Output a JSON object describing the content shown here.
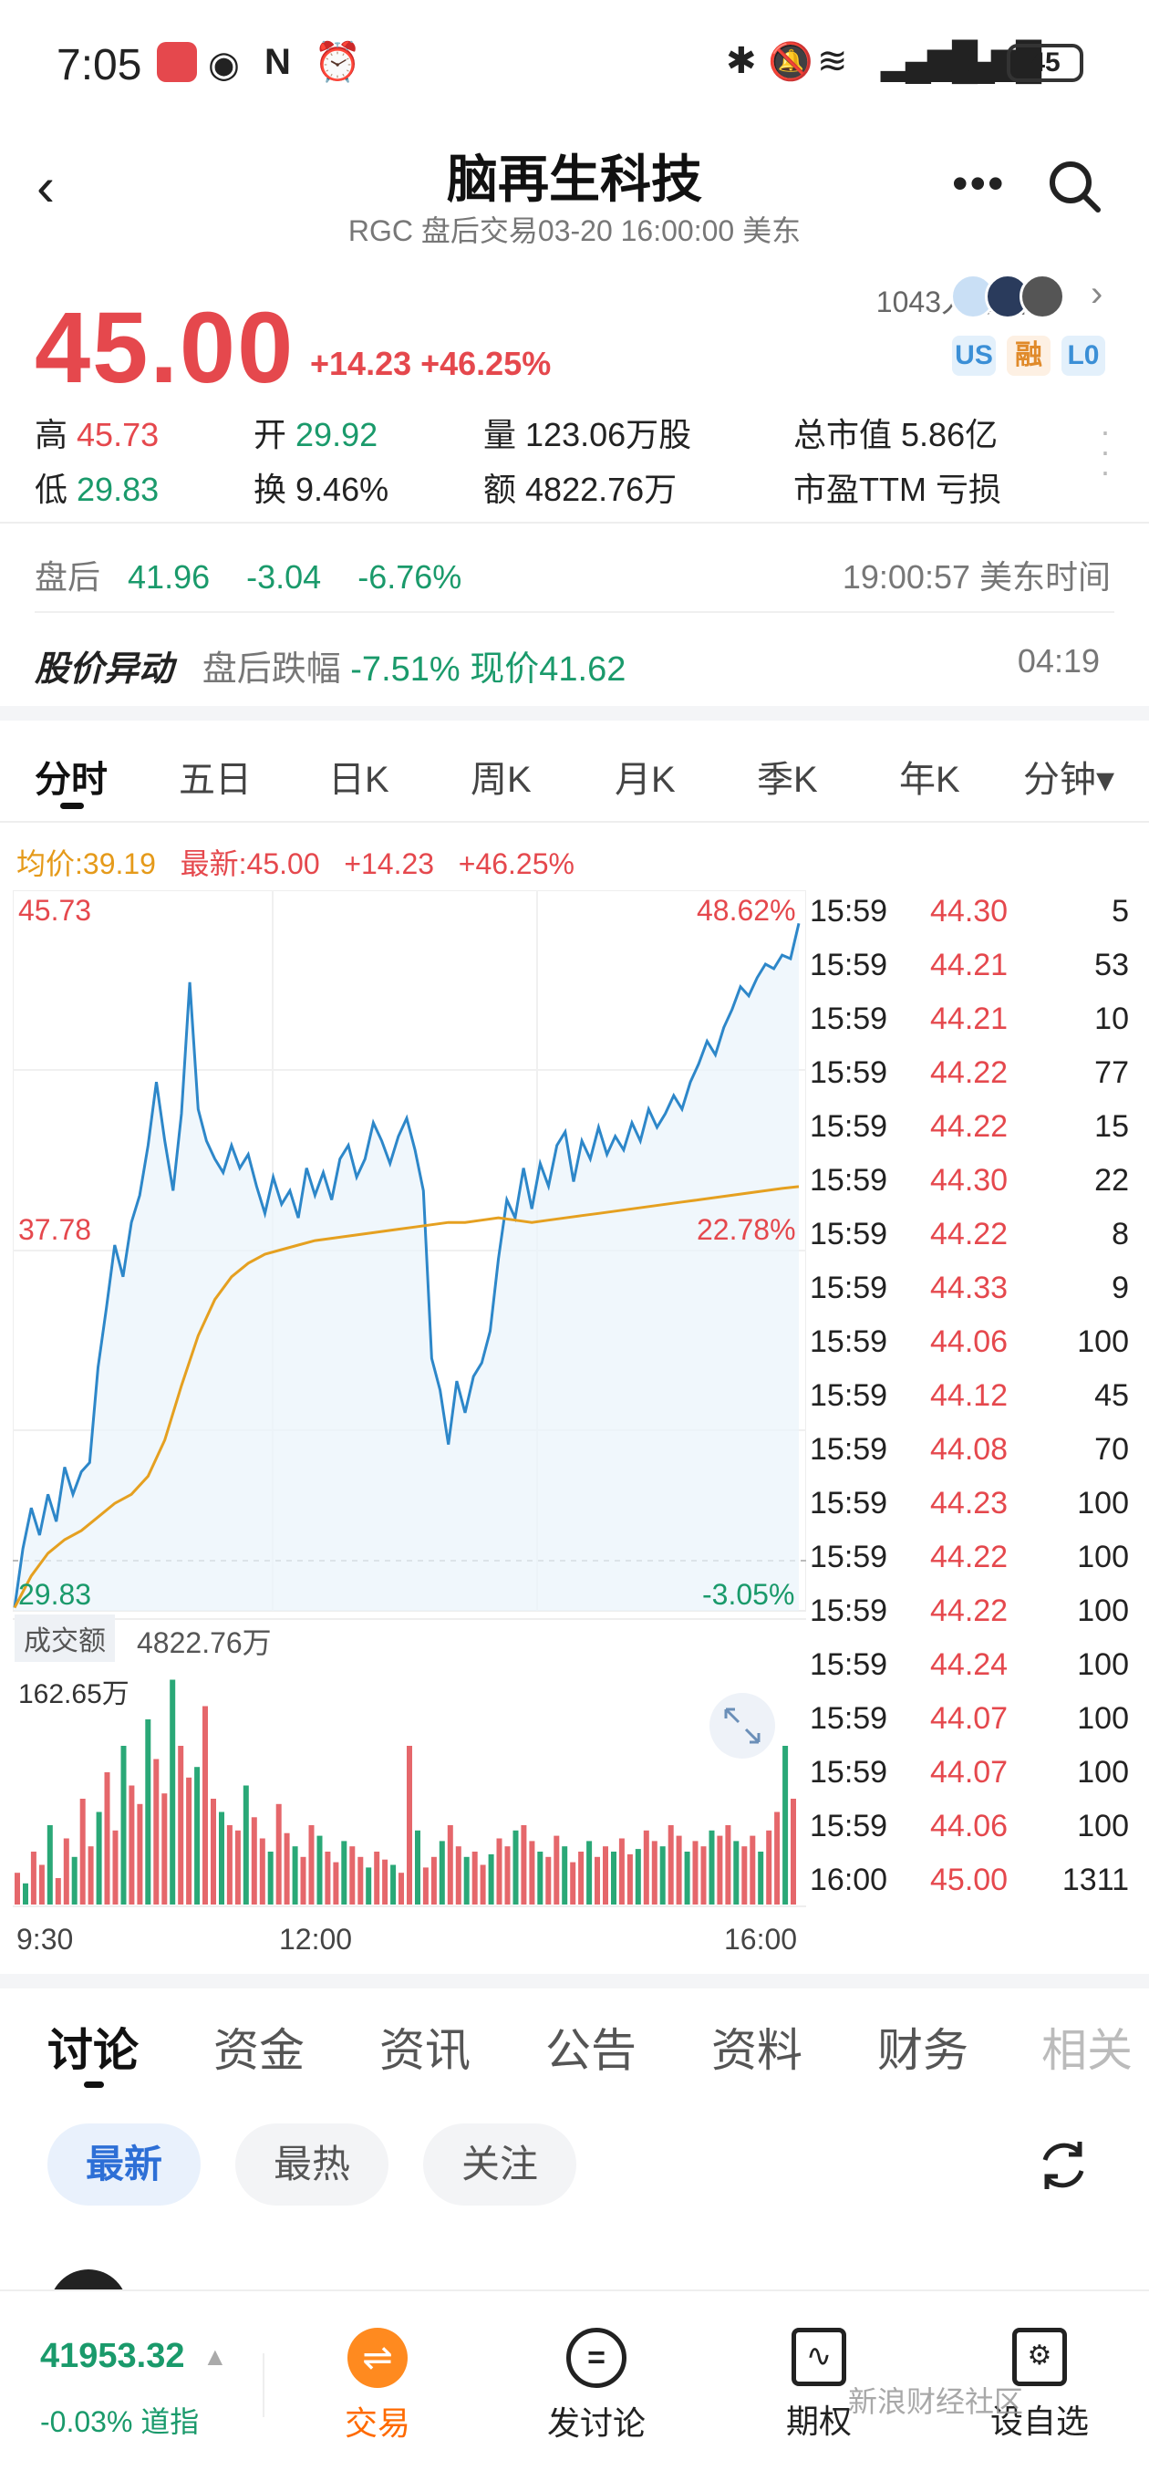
{
  "status_bar": {
    "time": "7:05",
    "battery": "45"
  },
  "header": {
    "back_icon": "chevron-left-icon",
    "title": "脑再生科技",
    "subtitle": "RGC 盘后交易03-20 16:00:00 美东",
    "more_icon": "more-icon",
    "search_icon": "search-icon"
  },
  "quote": {
    "price": "45.00",
    "change": "+14.23 +46.25%",
    "followers": "1043人加自选",
    "badges": [
      "US",
      "融",
      "L0"
    ],
    "high_label": "高",
    "high": "45.73",
    "open_label": "开",
    "open": "29.92",
    "volume_label": "量",
    "volume": "123.06万股",
    "mktcap_label": "总市值",
    "mktcap": "5.86亿",
    "low_label": "低",
    "low": "29.83",
    "turnover_label": "换",
    "turnover": "9.46%",
    "amount_label": "额",
    "amount": "4822.76万",
    "pe_label": "市盈TTM",
    "pe": "亏损"
  },
  "afterhours": {
    "label": "盘后",
    "price": "41.96",
    "change": "-3.04",
    "pct": "-6.76%",
    "time": "19:00:57 美东时间"
  },
  "alert": {
    "title": "股价异动",
    "text": "盘后跌幅",
    "pct": "-7.51%",
    "now": "现价41.62",
    "time": "04:19"
  },
  "chart_tabs": [
    "分时",
    "五日",
    "日K",
    "周K",
    "月K",
    "季K",
    "年K",
    "分钟▾"
  ],
  "chart_info": {
    "avg": "均价:39.19",
    "latest": "最新:45.00",
    "chg": "+14.23",
    "pct": "+46.25%"
  },
  "chart_data": {
    "type": "line",
    "y_left": {
      "top": "45.73",
      "mid": "37.78",
      "bottom": "29.83"
    },
    "y_right": {
      "top": "48.62%",
      "mid": "22.78%",
      "bottom": "-3.05%"
    },
    "ylim": [
      29.83,
      45.73
    ],
    "x_labels": [
      "9:30",
      "12:00",
      "16:00"
    ],
    "series": [
      {
        "values": [
          29.9,
          31.2,
          32.1,
          31.5,
          32.4,
          31.8,
          33.0,
          32.4,
          32.9,
          33.1,
          35.2,
          36.5,
          37.9,
          37.2,
          38.4,
          39.0,
          40.1,
          41.5,
          40.2,
          39.1,
          40.8,
          43.7,
          40.9,
          40.2,
          39.8,
          39.5,
          40.1,
          39.6,
          39.9,
          39.2,
          38.6,
          39.4,
          38.8,
          39.1,
          38.5,
          39.6,
          39.0,
          39.5,
          38.9,
          39.8,
          40.1,
          39.4,
          39.8,
          40.6,
          40.2,
          39.7,
          40.3,
          40.7,
          40.0,
          39.1,
          35.4,
          34.7,
          33.5,
          34.9,
          34.2,
          35.0,
          35.3,
          36.0,
          37.6,
          38.9,
          38.5,
          39.6,
          38.7,
          39.7,
          39.2,
          40.1,
          40.4,
          39.3,
          40.2,
          39.8,
          40.5,
          39.9,
          40.3,
          40.0,
          40.6,
          40.2,
          40.9,
          40.5,
          40.8,
          41.2,
          40.9,
          41.5,
          41.9,
          42.4,
          42.1,
          42.7,
          43.1,
          43.6,
          43.4,
          43.8,
          44.1,
          44.0,
          44.3,
          44.22,
          45.0
        ]
      },
      {
        "values": [
          29.9,
          30.6,
          31.1,
          31.4,
          31.6,
          31.9,
          32.2,
          32.4,
          32.8,
          33.6,
          34.8,
          35.9,
          36.7,
          37.2,
          37.5,
          37.7,
          37.8,
          37.9,
          38.0,
          38.05,
          38.1,
          38.15,
          38.2,
          38.25,
          38.3,
          38.35,
          38.4,
          38.4,
          38.45,
          38.5,
          38.45,
          38.4,
          38.45,
          38.5,
          38.55,
          38.6,
          38.65,
          38.7,
          38.75,
          38.8,
          38.85,
          38.9,
          38.95,
          39.0,
          39.05,
          39.1,
          39.15,
          39.19
        ]
      }
    ]
  },
  "volume": {
    "label": "成交额",
    "total": "4822.76万",
    "max": "162.65万",
    "bars": [
      12,
      8,
      20,
      15,
      30,
      10,
      25,
      18,
      40,
      22,
      35,
      50,
      28,
      60,
      45,
      38,
      70,
      55,
      42,
      85,
      60,
      48,
      52,
      75,
      40,
      35,
      30,
      28,
      45,
      33,
      25,
      20,
      38,
      27,
      22,
      18,
      30,
      26,
      20,
      16,
      24,
      22,
      18,
      14,
      20,
      17,
      15,
      12,
      60,
      28,
      14,
      18,
      24,
      30,
      22,
      18,
      20,
      15,
      19,
      25,
      22,
      28,
      30,
      24,
      20,
      18,
      26,
      22,
      16,
      20,
      24,
      18,
      22,
      20,
      25,
      19,
      21,
      28,
      24,
      22,
      30,
      26,
      20,
      24,
      22,
      28,
      26,
      30,
      24,
      22,
      26,
      20,
      28,
      35,
      60,
      40
    ]
  },
  "ticks": [
    [
      "15:59",
      "44.30",
      "5"
    ],
    [
      "15:59",
      "44.21",
      "53"
    ],
    [
      "15:59",
      "44.21",
      "10"
    ],
    [
      "15:59",
      "44.22",
      "77"
    ],
    [
      "15:59",
      "44.22",
      "15"
    ],
    [
      "15:59",
      "44.30",
      "22"
    ],
    [
      "15:59",
      "44.22",
      "8"
    ],
    [
      "15:59",
      "44.33",
      "9"
    ],
    [
      "15:59",
      "44.06",
      "100"
    ],
    [
      "15:59",
      "44.12",
      "45"
    ],
    [
      "15:59",
      "44.08",
      "70"
    ],
    [
      "15:59",
      "44.23",
      "100"
    ],
    [
      "15:59",
      "44.22",
      "100"
    ],
    [
      "15:59",
      "44.22",
      "100"
    ],
    [
      "15:59",
      "44.24",
      "100"
    ],
    [
      "15:59",
      "44.07",
      "100"
    ],
    [
      "15:59",
      "44.07",
      "100"
    ],
    [
      "15:59",
      "44.06",
      "100"
    ],
    [
      "16:00",
      "45.00",
      "1311"
    ]
  ],
  "bottom_tabs": [
    "讨论",
    "资金",
    "资讯",
    "公告",
    "资料",
    "财务",
    "相关"
  ],
  "pills": [
    "最新",
    "最热",
    "关注"
  ],
  "nav": {
    "index_value": "41953.32",
    "index_change": "-0.03%",
    "index_name": "道指",
    "items": [
      "交易",
      "发讨论",
      "期权",
      "设自选"
    ],
    "watermark": "新浪财经社区"
  }
}
